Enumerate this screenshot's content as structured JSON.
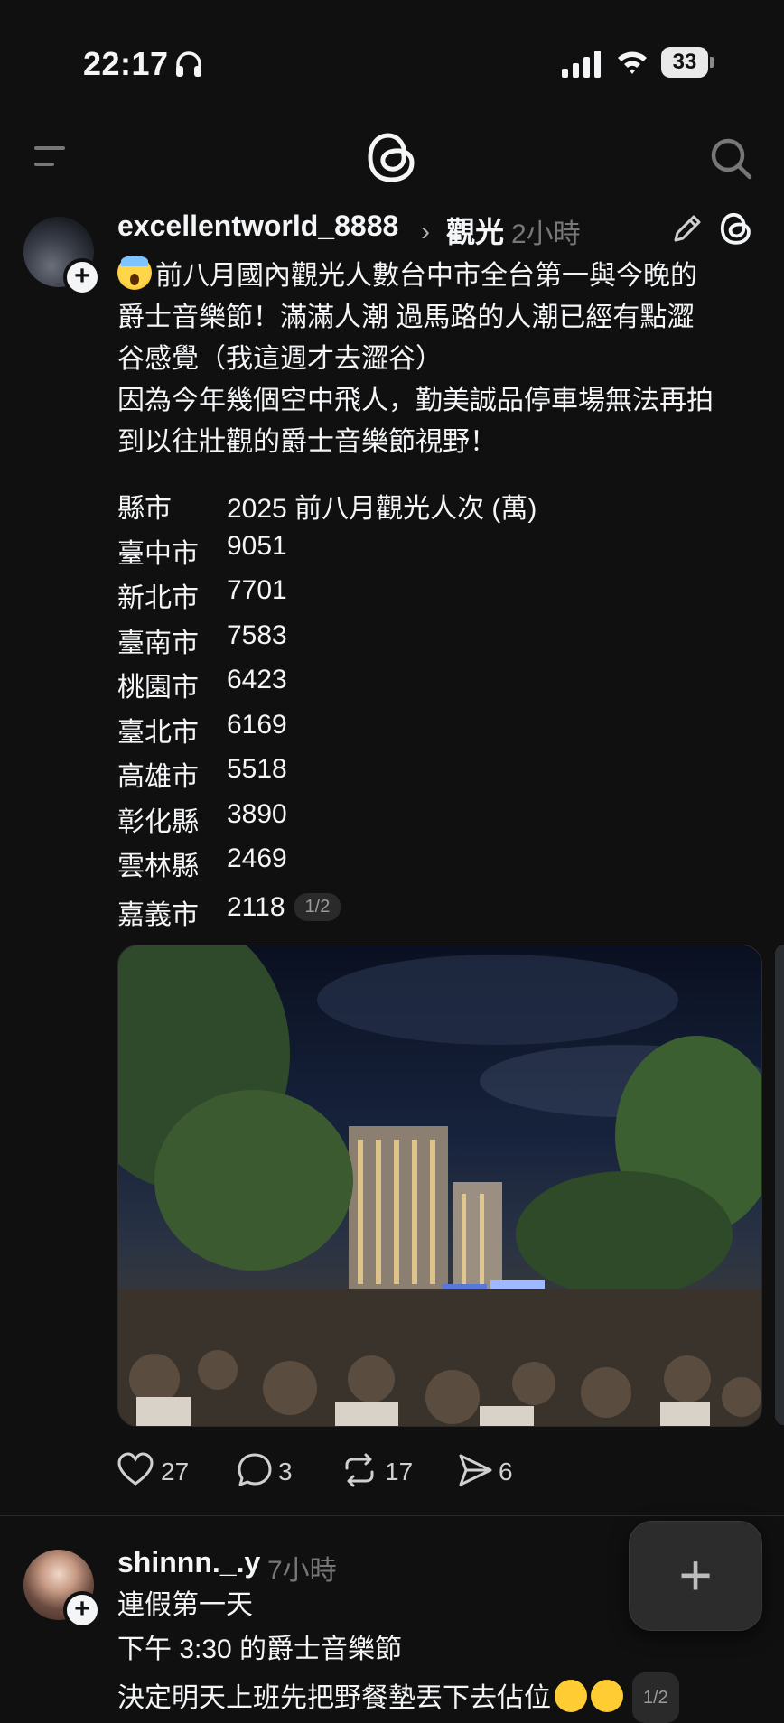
{
  "status_bar": {
    "time": "22:17",
    "battery": "33"
  },
  "nav": {
    "menu_icon": "menu-icon",
    "logo_icon": "threads-logo",
    "search_icon": "search-icon"
  },
  "post1": {
    "username": "excellentworld_8888",
    "topic": "觀光",
    "time_ago": "2小時",
    "lines": [
      "前八月國內觀光人數台中市全台第一與今晚的",
      "爵士音樂節！滿滿人潮 過馬路的人潮已經有點澀",
      "谷感覺（我這週才去澀谷）",
      "因為今年幾個空中飛人，勤美誠品停車場無法再拍",
      "到以往壯觀的爵士音樂節視野！"
    ],
    "table_header": [
      "縣市",
      "2025 前八月觀光人次 (萬)"
    ],
    "table_rows": [
      [
        "臺中市",
        "9051"
      ],
      [
        "新北市",
        "7701"
      ],
      [
        "臺南市",
        "7583"
      ],
      [
        "桃園市",
        "6423"
      ],
      [
        "臺北市",
        "6169"
      ],
      [
        "高雄市",
        "5518"
      ],
      [
        "彰化縣",
        "3890"
      ],
      [
        "雲林縣",
        "2469"
      ],
      [
        "嘉義市",
        "2118"
      ]
    ],
    "page_indicator": "1/2",
    "actions": {
      "likes": "27",
      "replies": "3",
      "reposts": "17",
      "shares": "6"
    }
  },
  "post2": {
    "username": "shinnn._.y",
    "time_ago": "7小時",
    "lines": [
      "連假第一天",
      "下午 3:30 的爵士音樂節",
      "決定明天上班先把野餐墊丟下去佔位"
    ],
    "page_indicator": "1/2"
  }
}
